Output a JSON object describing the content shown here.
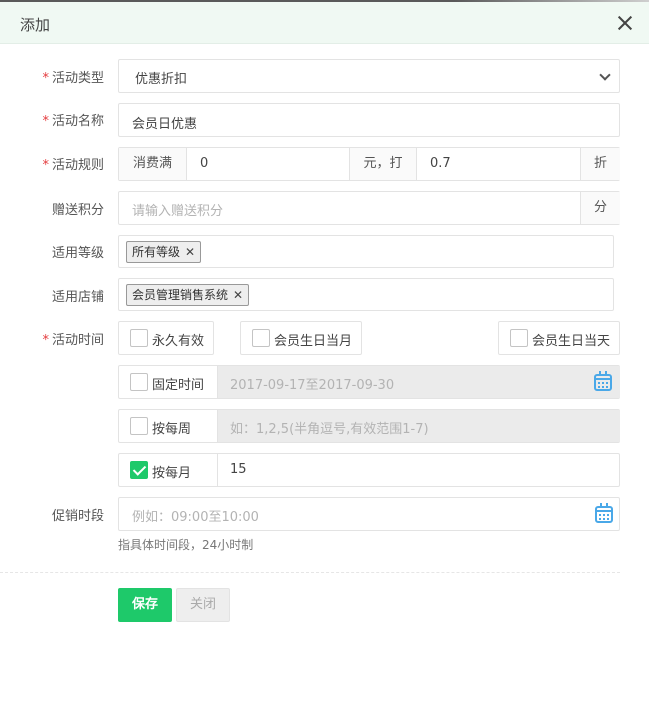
{
  "dialog": {
    "title": "添加"
  },
  "form": {
    "activity_type": {
      "label": "活动类型",
      "required": "*",
      "value": "优惠折扣"
    },
    "activity_name": {
      "label": "活动名称",
      "required": "*",
      "value": "会员日优惠"
    },
    "activity_rule": {
      "label": "活动规则",
      "required": "*",
      "prefix": "消费满",
      "amount": "0",
      "middle": "元，打",
      "discount": "0.7",
      "suffix": "折"
    },
    "bonus_points": {
      "label": "赠送积分",
      "placeholder": "请输入赠送积分",
      "suffix": "分"
    },
    "levels": {
      "label": "适用等级",
      "tags": [
        "所有等级"
      ]
    },
    "stores": {
      "label": "适用店铺",
      "tags": [
        "会员管理销售系统"
      ]
    },
    "activity_time": {
      "label": "活动时间",
      "required": "*",
      "permanent": "永久有效",
      "birthday_month": "会员生日当月",
      "birthday_day": "会员生日当天",
      "fixed_time": {
        "label": "固定时间",
        "value": "2017-09-17至2017-09-30",
        "checked": false
      },
      "weekly": {
        "label": "按每周",
        "placeholder": "如：1,2,5(半角逗号,有效范围1-7)",
        "checked": false
      },
      "monthly": {
        "label": "按每月",
        "value": "15",
        "checked": true
      }
    },
    "promo_period": {
      "label": "促销时段",
      "placeholder": "例如：09:00至10:00",
      "hint": "指具体时间段，24小时制"
    }
  },
  "buttons": {
    "save": "保存",
    "close": "关闭"
  },
  "colors": {
    "accent": "#1ec96a",
    "header_bg": "#f0f9f3",
    "required": "#e4393c",
    "calendar_icon": "#4aa8e8"
  }
}
